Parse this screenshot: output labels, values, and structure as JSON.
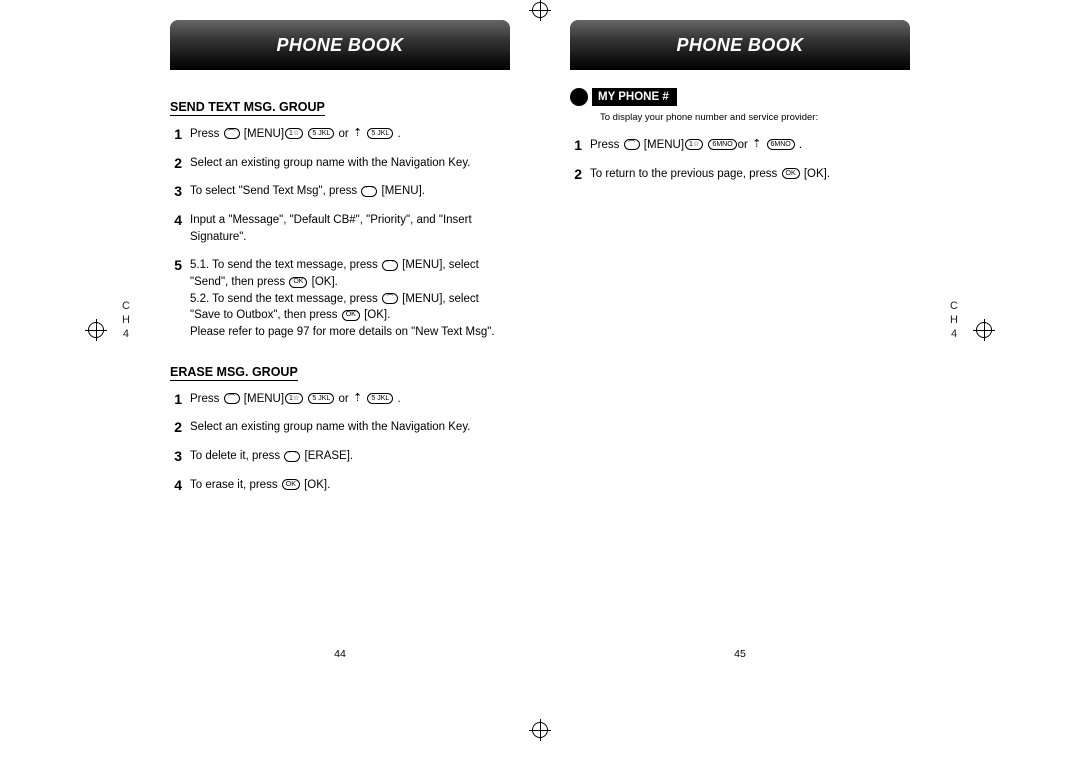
{
  "left": {
    "header": "PHONE BOOK",
    "chapter": "C\nH\n4",
    "section1": {
      "title": "SEND TEXT MSG. GROUP",
      "steps": [
        {
          "num": "1",
          "prefix": "Press ",
          "menu": "[MENU]",
          "btn1": "1☆",
          "btn2": "5 JKL",
          "mid": " or ",
          "suffix": " ."
        },
        {
          "num": "2",
          "text": "Select an existing group name with the Navigation Key."
        },
        {
          "num": "3",
          "prefix": "To select \"Send Text Msg\", press ",
          "menu": "[MENU].",
          "btn": true
        },
        {
          "num": "4",
          "text": "Input a \"Message\", \"Default CB#\", \"Priority\", and \"Insert Signature\"."
        },
        {
          "num": "5",
          "l1": "5.1. To send the text message, press",
          "l1b": "[MENU], select \"Send\", then press",
          "l1c": "[OK].",
          "l2": "5.2. To send the text message, press",
          "l2b": "[MENU], select \"Save to Outbox\", then press",
          "l2c": "[OK].",
          "l3": "Please refer to page 97 for more details on \"New Text Msg\"."
        }
      ]
    },
    "section2": {
      "title": "ERASE MSG. GROUP",
      "steps": [
        {
          "num": "1",
          "prefix": "Press ",
          "menu": "[MENU]",
          "btn1": "1☆",
          "btn2": "5 JKL",
          "mid": " or ",
          "suffix": " ."
        },
        {
          "num": "2",
          "text": "Select an existing group name with the Navigation Key."
        },
        {
          "num": "3",
          "prefix": "To delete it, press ",
          "menu": "[ERASE].",
          "btn": true
        },
        {
          "num": "4",
          "prefix": "To erase it, press ",
          "menu": "[OK].",
          "btn": true
        }
      ]
    },
    "pagenum": "44"
  },
  "right": {
    "header": "PHONE BOOK",
    "chapter": "C\nH\n4",
    "badge": "MY PHONE #",
    "subtext": "To display your phone number and service provider:",
    "steps": [
      {
        "num": "1",
        "prefix": "Press ",
        "menu": "[MENU]",
        "btn1": "1☆",
        "btn2": "6MNO",
        "mid": "or ",
        "suffix": " ."
      },
      {
        "num": "2",
        "prefix": "To return to the previous page, press ",
        "menu": "[OK].",
        "btn": true
      }
    ],
    "pagenum": "45"
  },
  "icons": {
    "softkey": "◠",
    "ok": "OK",
    "up": "⇡",
    "nav": "✥"
  }
}
